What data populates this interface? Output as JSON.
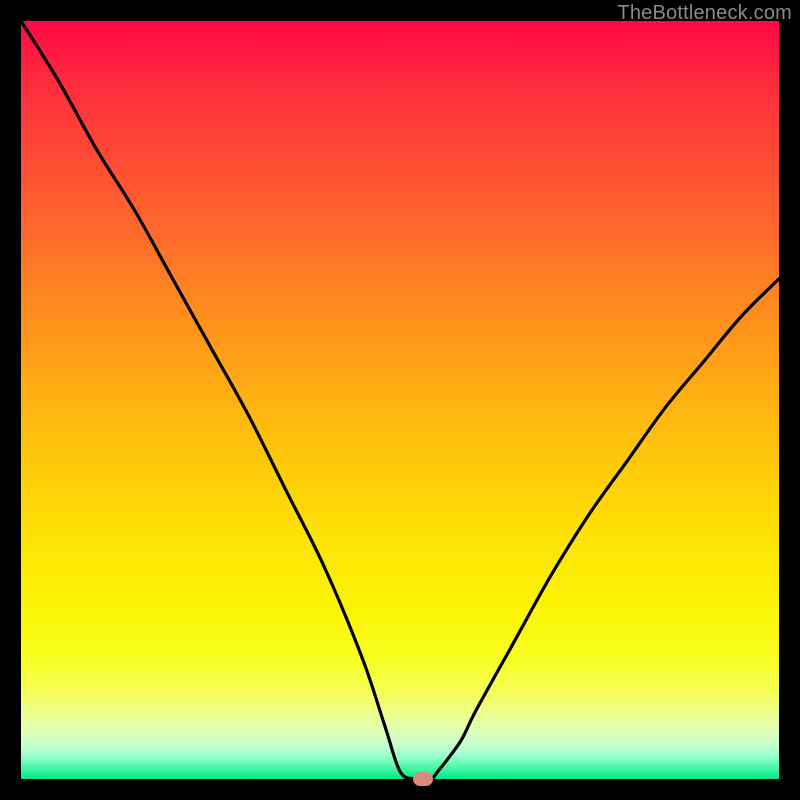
{
  "watermark": "TheBottleneck.com",
  "chart_data": {
    "type": "line",
    "title": "",
    "xlabel": "",
    "ylabel": "",
    "xlim": [
      0,
      100
    ],
    "ylim": [
      0,
      100
    ],
    "series": [
      {
        "name": "bottleneck-curve",
        "x": [
          0,
          5,
          10,
          15,
          20,
          25,
          30,
          35,
          40,
          45,
          48,
          50,
          52,
          54,
          55,
          58,
          60,
          65,
          70,
          75,
          80,
          85,
          90,
          95,
          100
        ],
        "values": [
          100,
          92,
          83,
          75,
          66,
          57,
          48,
          38,
          28,
          16,
          7,
          1,
          0,
          0,
          1,
          5,
          9,
          18,
          27,
          35,
          42,
          49,
          55,
          61,
          66
        ]
      }
    ],
    "marker": {
      "x": 53,
      "y": 0,
      "color": "#d68b7d"
    },
    "gradient_stops": [
      {
        "pct": 0,
        "color": "#ff0846"
      },
      {
        "pct": 50,
        "color": "#ffab14"
      },
      {
        "pct": 85,
        "color": "#f8fe21"
      },
      {
        "pct": 100,
        "color": "#00e887"
      }
    ]
  }
}
